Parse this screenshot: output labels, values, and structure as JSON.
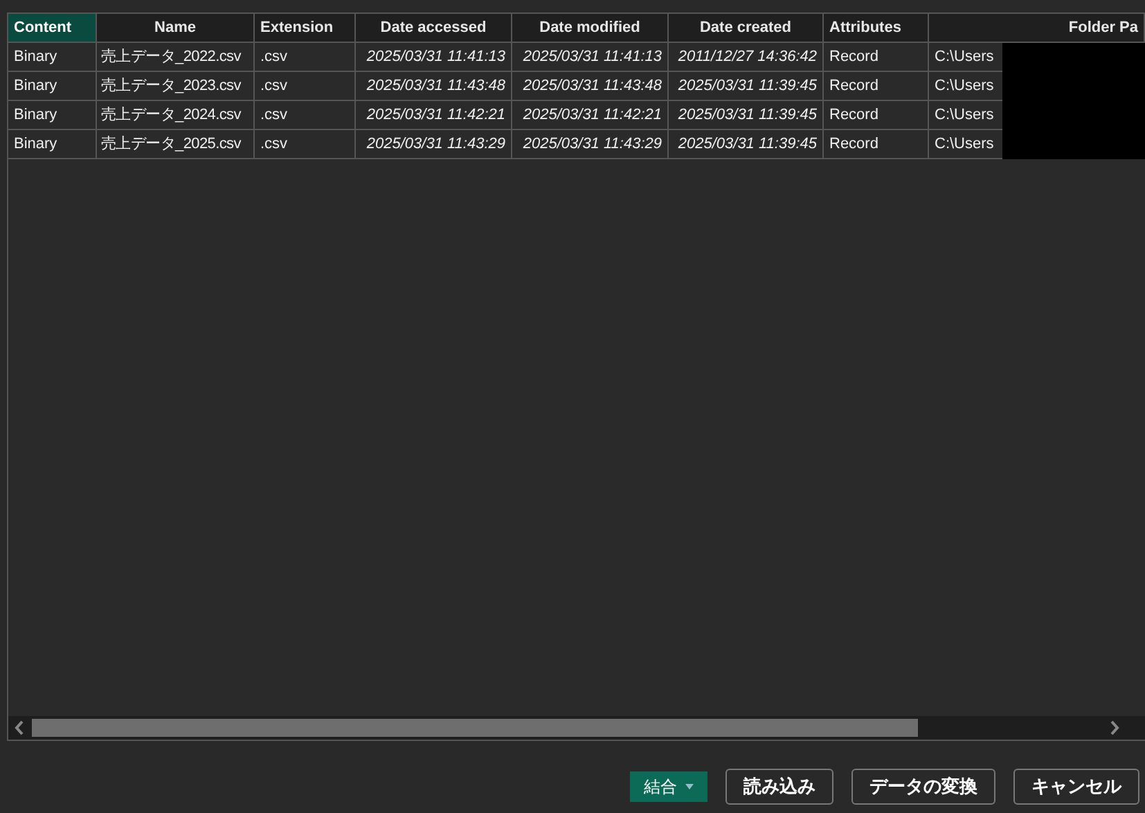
{
  "table": {
    "columns": [
      {
        "label": "Content",
        "selected": true
      },
      {
        "label": "Name",
        "selected": false
      },
      {
        "label": "Extension",
        "selected": false
      },
      {
        "label": "Date accessed",
        "selected": false
      },
      {
        "label": "Date modified",
        "selected": false
      },
      {
        "label": "Date created",
        "selected": false
      },
      {
        "label": "Attributes",
        "selected": false
      },
      {
        "label": "Folder Pa",
        "selected": false
      }
    ],
    "rows": [
      {
        "content": "Binary",
        "name": "売上データ_2022.csv",
        "extension": ".csv",
        "date_accessed": "2025/03/31 11:41:13",
        "date_modified": "2025/03/31 11:41:13",
        "date_created": "2011/12/27 14:36:42",
        "attributes": "Record",
        "folder_path": "C:\\Users"
      },
      {
        "content": "Binary",
        "name": "売上データ_2023.csv",
        "extension": ".csv",
        "date_accessed": "2025/03/31 11:43:48",
        "date_modified": "2025/03/31 11:43:48",
        "date_created": "2025/03/31 11:39:45",
        "attributes": "Record",
        "folder_path": "C:\\Users"
      },
      {
        "content": "Binary",
        "name": "売上データ_2024.csv",
        "extension": ".csv",
        "date_accessed": "2025/03/31 11:42:21",
        "date_modified": "2025/03/31 11:42:21",
        "date_created": "2025/03/31 11:39:45",
        "attributes": "Record",
        "folder_path": "C:\\Users"
      },
      {
        "content": "Binary",
        "name": "売上データ_2025.csv",
        "extension": ".csv",
        "date_accessed": "2025/03/31 11:43:29",
        "date_modified": "2025/03/31 11:43:29",
        "date_created": "2025/03/31 11:39:45",
        "attributes": "Record",
        "folder_path": "C:\\Users"
      }
    ]
  },
  "buttons": [
    {
      "label": "結合",
      "kind": "split"
    },
    {
      "label": "読み込み",
      "kind": "outline"
    },
    {
      "label": "データの変換",
      "kind": "outline"
    },
    {
      "label": "キャンセル",
      "kind": "outline"
    }
  ]
}
